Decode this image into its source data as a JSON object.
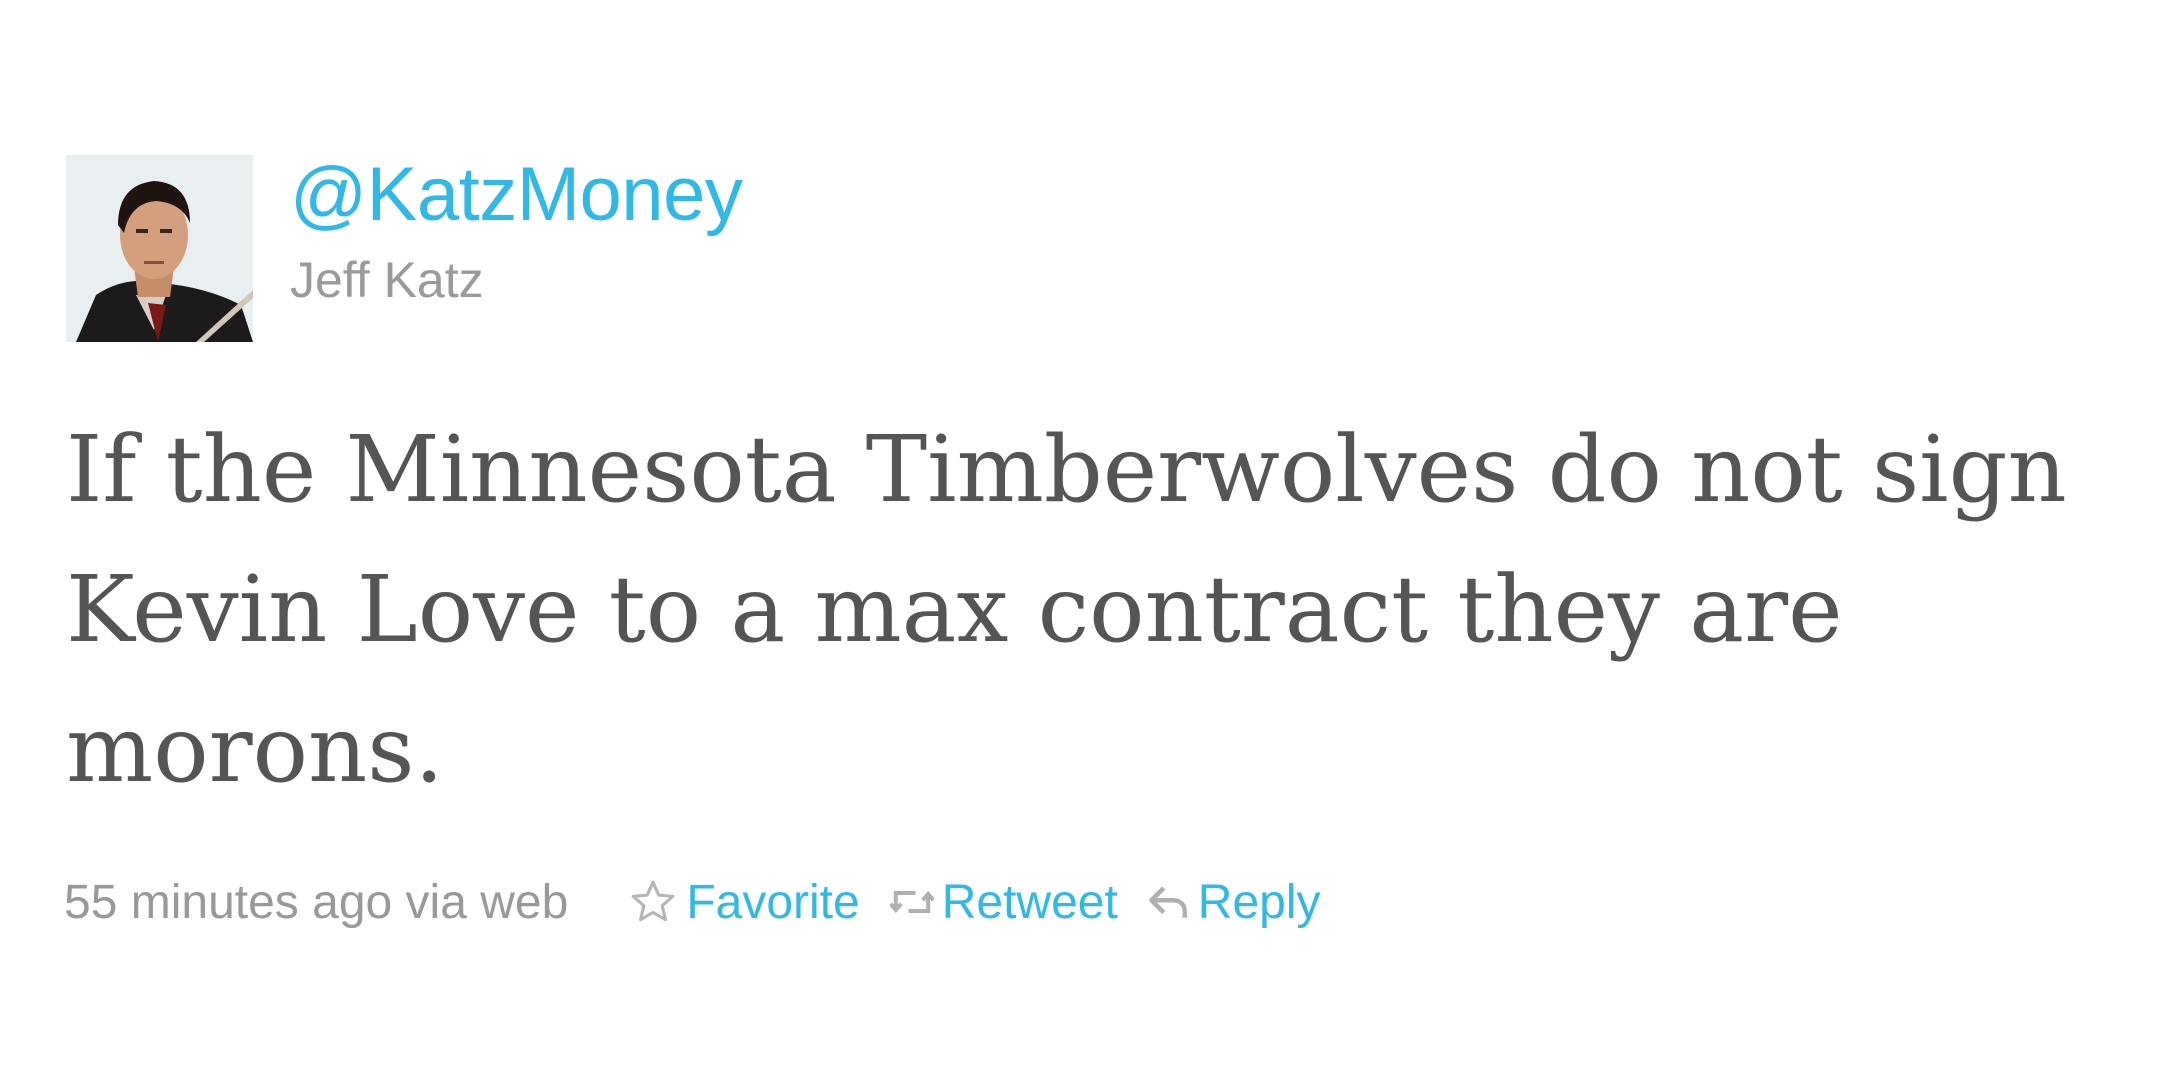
{
  "tweet": {
    "handle": "@KatzMoney",
    "name": "Jeff Katz",
    "text": "If the Minnesota Timberwolves do not sign Kevin Love to a max contract they are morons.",
    "timestamp": "55 minutes ago via web"
  },
  "actions": {
    "favorite": "Favorite",
    "retweet": "Retweet",
    "reply": "Reply"
  },
  "colors": {
    "link": "#2fb9e6",
    "text": "#555555",
    "muted": "#999999"
  },
  "icons": {
    "favorite": "star-icon",
    "retweet": "retweet-icon",
    "reply": "reply-arrow-icon"
  }
}
